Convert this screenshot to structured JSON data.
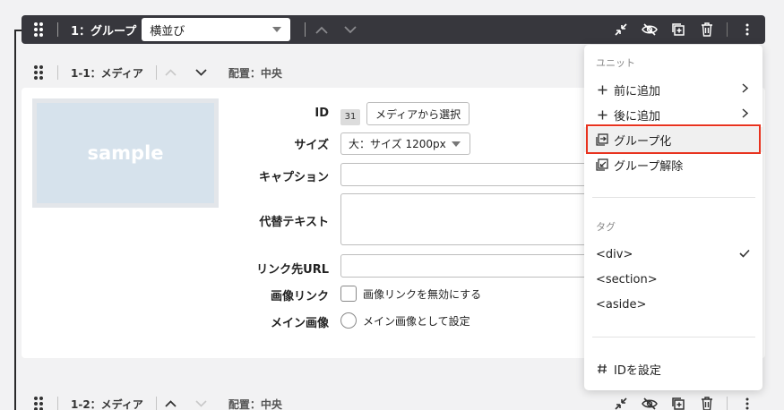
{
  "group": {
    "title": "1：グループ",
    "layout_value": "横並び"
  },
  "unit1": {
    "title": "1-1：メディア",
    "placement": "配置：中央",
    "thumbnail_text": "sample",
    "fields": {
      "id_label": "ID",
      "id_value": "31",
      "select_media_button": "メディアから選択",
      "size_label": "サイズ",
      "size_value": "大：サイズ 1200px",
      "caption_label": "キャプション",
      "alt_label": "代替テキスト",
      "link_label": "リンク先URL",
      "image_link_label": "画像リンク",
      "image_link_option": "画像リンクを無効にする",
      "main_image_label": "メイン画像",
      "main_image_option": "メイン画像として設定"
    }
  },
  "unit2": {
    "title": "1-2：メディア",
    "placement": "配置：中央"
  },
  "menu": {
    "unit_heading": "ユニット",
    "add_before": "前に追加",
    "add_after": "後に追加",
    "group": "グループ化",
    "ungroup": "グループ解除",
    "tag_heading": "タグ",
    "tags": [
      "<div>",
      "<section>",
      "<aside>"
    ],
    "selected_tag": "<div>",
    "set_id": "IDを設定"
  },
  "colors": {
    "header_bar": "#37373d",
    "highlight_border": "#e8321e",
    "thumbnail": "#d6e2ec"
  }
}
